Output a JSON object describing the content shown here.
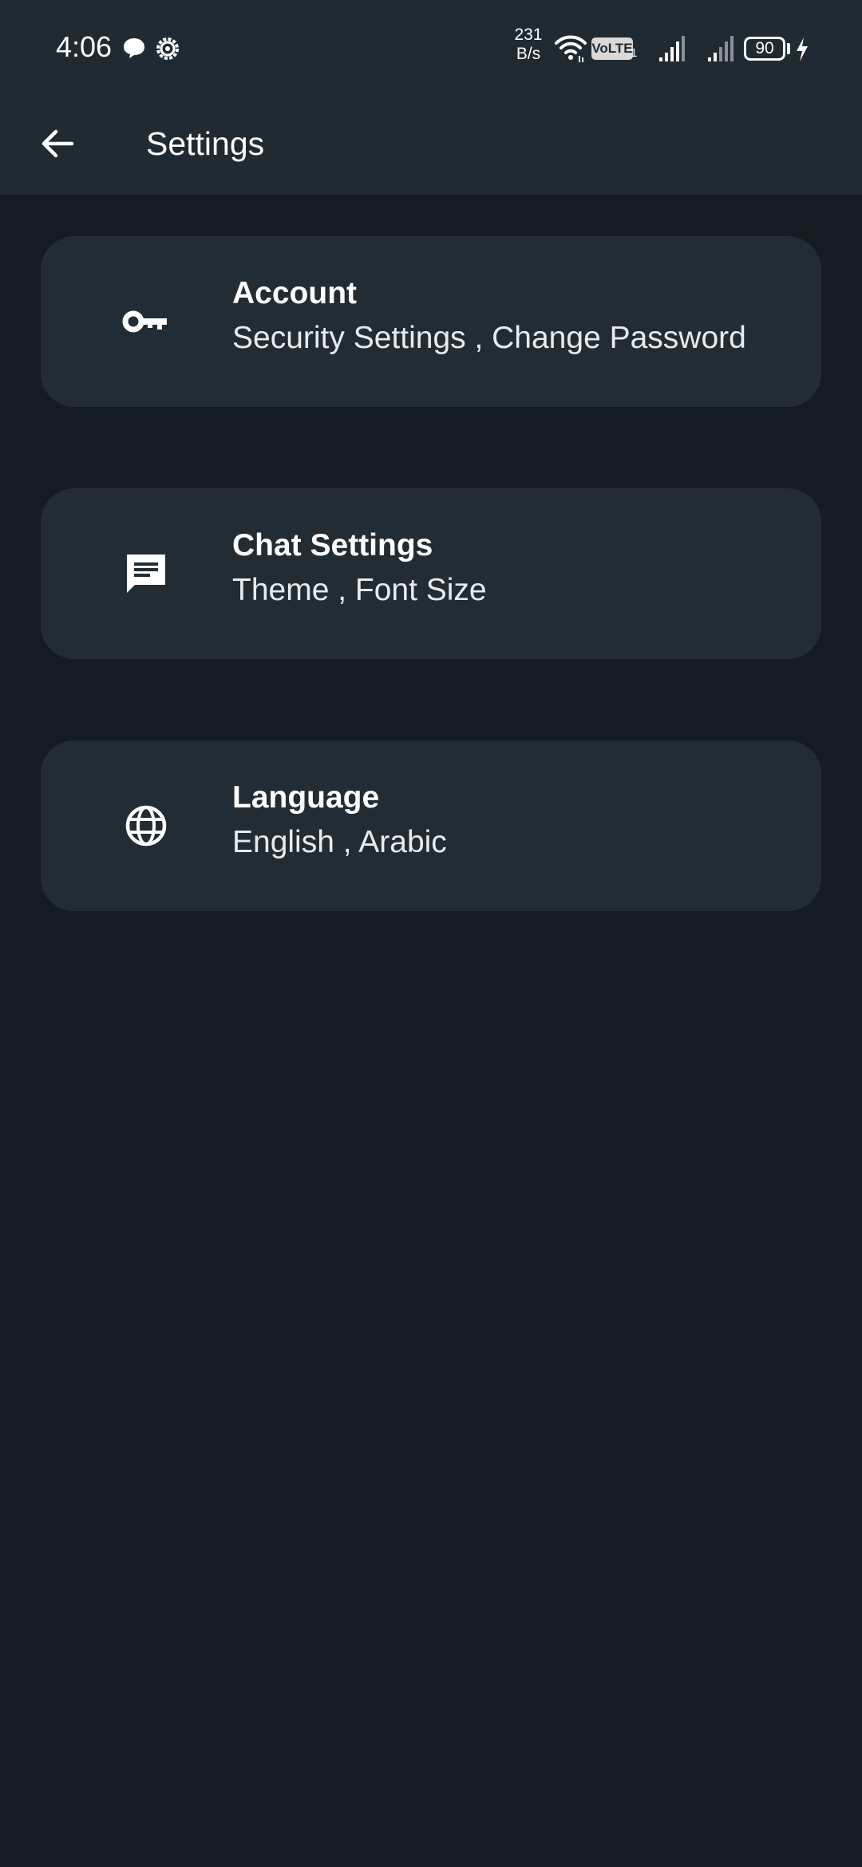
{
  "status_bar": {
    "time": "4:06",
    "net_speed_value": "231",
    "net_speed_unit": "B/s",
    "volte_label": "VoLTE",
    "sim_index": "1",
    "battery_level": "90",
    "charging": true,
    "left_icons": [
      "chat-bubble-icon",
      "gear-notification-icon"
    ],
    "right_icons": [
      "wifi-icon",
      "signal-sim1-icon",
      "signal-sim2-icon",
      "charging-bolt-icon"
    ]
  },
  "app_bar": {
    "title": "Settings",
    "back_icon": "arrow-back-icon"
  },
  "settings_items": [
    {
      "id": "account",
      "icon": "key-icon",
      "title": "Account",
      "subtitle": "Security Settings , Change Password"
    },
    {
      "id": "chat-settings",
      "icon": "chat-message-icon",
      "title": "Chat Settings",
      "subtitle": "Theme , Font Size"
    },
    {
      "id": "language",
      "icon": "globe-icon",
      "title": "Language",
      "subtitle": "English , Arabic"
    }
  ],
  "colors": {
    "background": "#151b22",
    "app_bar": "#202a32",
    "card": "#222c34",
    "text_primary": "#ffffff"
  }
}
